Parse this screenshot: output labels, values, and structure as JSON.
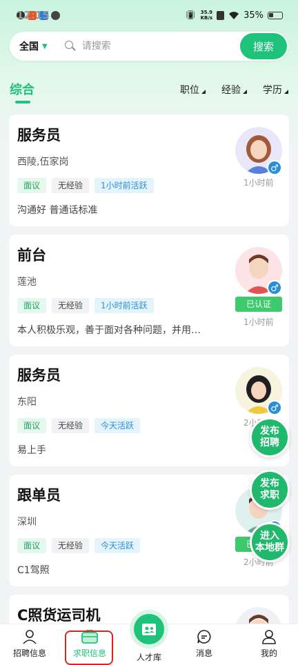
{
  "statusbar": {
    "time": "12:15",
    "netspeed_value": "35.9",
    "netspeed_unit": "KB/s",
    "battery": "35%"
  },
  "search": {
    "region": "全国",
    "placeholder": "请搜索",
    "button": "搜索"
  },
  "filters": {
    "active_tab": "综合",
    "position": "职位",
    "experience": "经验",
    "education": "学历"
  },
  "cards": [
    {
      "title": "服务员",
      "location": "西陵,伍家岗",
      "salary": "面议",
      "experience": "无经验",
      "activity": "1小时前活跃",
      "desc": "沟通好 普通话标准",
      "time": "1小时前",
      "verified": ""
    },
    {
      "title": "前台",
      "location": "莲池",
      "salary": "面议",
      "experience": "无经验",
      "activity": "1小时前活跃",
      "desc": "本人积极乐观，善于面对各种问题，并用…",
      "time": "1小时前",
      "verified": "已认证"
    },
    {
      "title": "服务员",
      "location": "东阳",
      "salary": "面议",
      "experience": "无经验",
      "activity": "今天活跃",
      "desc": "易上手",
      "time": "2小时前",
      "verified": ""
    },
    {
      "title": "跟单员",
      "location": "深圳",
      "salary": "面议",
      "experience": "无经验",
      "activity": "今天活跃",
      "desc": "C1驾照",
      "time": "2小时前",
      "verified": "已认证"
    },
    {
      "title": "C照货运司机"
    }
  ],
  "fabs": {
    "post_job": "发布\n招聘",
    "post_resume": "发布\n求职",
    "join_group": "进入\n本地群"
  },
  "nav": {
    "recruit": "招聘信息",
    "jobseek": "求职信息",
    "talent": "人才库",
    "messages": "消息",
    "mine": "我的"
  },
  "colors": {
    "accent": "#1ec27a",
    "highlight": "#e0201e"
  }
}
